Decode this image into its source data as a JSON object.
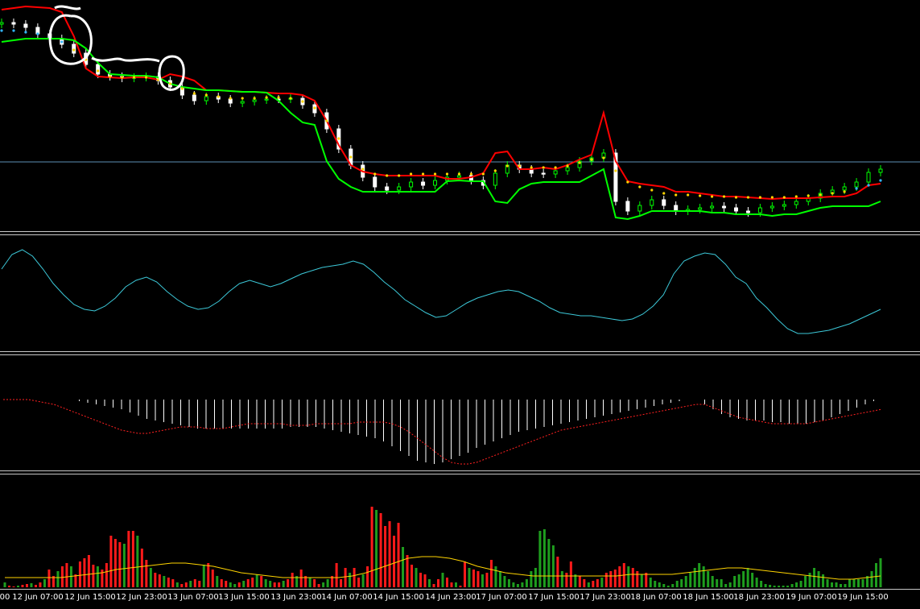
{
  "app": {
    "name": "trading-terminal-chart"
  },
  "colors": {
    "background": "#000000",
    "bull_candle": "#00ff00",
    "bear_candle": "#ffffff",
    "upper_band": "#ff0000",
    "lower_band": "#00ff00",
    "ma_dots": "#ffd400",
    "ma_dots_alt": "#33b5ff",
    "oscillator_line": "#3cc8d8",
    "histogram": "#ffffff",
    "signal_line": "#ff2020",
    "volume_down": "#ff1a1a",
    "volume_up": "#1e9e1e",
    "volume_ma": "#ffd400",
    "horizontal_level": "#5d8fb5",
    "separator": "#c8c8c8",
    "annotation": "#ffffff"
  },
  "time_axis": {
    "labels": [
      "00",
      "12 Jun 07:00",
      "12 Jun 15:00",
      "12 Jun 23:00",
      "13 Jun 07:00",
      "13 Jun 15:00",
      "13 Jun 23:00",
      "14 Jun 07:00",
      "14 Jun 15:00",
      "14 Jun 23:00",
      "17 Jun 07:00",
      "17 Jun 15:00",
      "17 Jun 23:00",
      "18 Jun 07:00",
      "18 Jun 15:00",
      "18 Jun 23:00",
      "19 Jun 07:00",
      "19 Jun 15:00"
    ]
  },
  "chart_data": [
    {
      "type": "line",
      "panel": "price",
      "title": "",
      "close": [
        28,
        30,
        34,
        42,
        48,
        55,
        66,
        80,
        92,
        95,
        97,
        96,
        95,
        100,
        108,
        118,
        125,
        120,
        123,
        128,
        126,
        124,
        123,
        123,
        122,
        130,
        140,
        160,
        185,
        205,
        220,
        232,
        236,
        232,
        226,
        230,
        224,
        220,
        218,
        224,
        230,
        215,
        205,
        210,
        215,
        216,
        212,
        208,
        200,
        196,
        190,
        250,
        262,
        255,
        248,
        255,
        262,
        260,
        258,
        256,
        258,
        262,
        264,
        258,
        256,
        254,
        250,
        246,
        240,
        236,
        232,
        226,
        214,
        210
      ],
      "upper_band": [
        12,
        10,
        8,
        9,
        10,
        15,
        45,
        85,
        95,
        96,
        97,
        96,
        96,
        99,
        92,
        95,
        100,
        112,
        112,
        113,
        114,
        114,
        115,
        116,
        116,
        118,
        125,
        150,
        180,
        205,
        213,
        216,
        218,
        218,
        218,
        218,
        218,
        222,
        222,
        220,
        215,
        190,
        188,
        210,
        210,
        208,
        210,
        205,
        198,
        192,
        140,
        200,
        225,
        228,
        230,
        232,
        238,
        238,
        240,
        242,
        244,
        244,
        245,
        246,
        247,
        246,
        246,
        246,
        245,
        244,
        244,
        240,
        230,
        228
      ],
      "lower_band": [
        52,
        50,
        48,
        48,
        48,
        48,
        50,
        60,
        78,
        92,
        93,
        94,
        94,
        96,
        104,
        108,
        110,
        112,
        112,
        113,
        114,
        114,
        115,
        125,
        140,
        152,
        155,
        200,
        222,
        232,
        238,
        238,
        238,
        238,
        238,
        238,
        238,
        225,
        224,
        225,
        225,
        250,
        252,
        235,
        228,
        226,
        226,
        226,
        226,
        218,
        210,
        270,
        272,
        268,
        262,
        262,
        262,
        262,
        262,
        264,
        264,
        266,
        266,
        266,
        268,
        266,
        266,
        262,
        258,
        256,
        256,
        256,
        256,
        250
      ],
      "moving_average": [
        38,
        38,
        40,
        42,
        46,
        52,
        62,
        74,
        88,
        95,
        96,
        96,
        96,
        99,
        104,
        110,
        116,
        118,
        120,
        122,
        122,
        122,
        121,
        121,
        122,
        126,
        134,
        150,
        172,
        195,
        210,
        216,
        218,
        218,
        216,
        216,
        216,
        216,
        216,
        216,
        216,
        212,
        206,
        206,
        208,
        208,
        208,
        206,
        202,
        198,
        196,
        212,
        226,
        232,
        236,
        240,
        242,
        242,
        243,
        244,
        244,
        245,
        245,
        245,
        245,
        245,
        244,
        243,
        242,
        240,
        238,
        234,
        230,
        224
      ],
      "horizontal_level": 201
    },
    {
      "type": "line",
      "panel": "oscillator",
      "title": "",
      "values": [
        102,
        120,
        126,
        118,
        102,
        84,
        70,
        58,
        52,
        50,
        56,
        66,
        80,
        88,
        92,
        86,
        74,
        64,
        56,
        52,
        54,
        62,
        74,
        84,
        88,
        84,
        80,
        84,
        90,
        96,
        100,
        104,
        106,
        108,
        112,
        108,
        98,
        86,
        76,
        64,
        56,
        48,
        42,
        44,
        52,
        60,
        66,
        70,
        74,
        76,
        74,
        68,
        62,
        54,
        48,
        46,
        44,
        44,
        42,
        40,
        38,
        40,
        46,
        56,
        70,
        96,
        112,
        118,
        122,
        120,
        108,
        92,
        84,
        66,
        54,
        40,
        28,
        22,
        22,
        24,
        26,
        30,
        34,
        40,
        46,
        52
      ]
    },
    {
      "type": "bar",
      "panel": "macd",
      "title": "",
      "histogram": [
        0,
        0,
        0,
        0,
        0,
        0,
        0,
        0,
        0,
        -2,
        -4,
        -6,
        -8,
        -10,
        -12,
        -16,
        -20,
        -24,
        -26,
        -28,
        -30,
        -32,
        -34,
        -36,
        -36,
        -36,
        -36,
        -36,
        -36,
        -36,
        -36,
        -36,
        -36,
        -36,
        -34,
        -34,
        -34,
        -34,
        -36,
        -38,
        -40,
        -42,
        -44,
        -46,
        -48,
        -52,
        -58,
        -64,
        -70,
        -76,
        -78,
        -80,
        -78,
        -74,
        -70,
        -66,
        -60,
        -56,
        -52,
        -48,
        -44,
        -40,
        -38,
        -36,
        -34,
        -32,
        -30,
        -28,
        -26,
        -24,
        -22,
        -20,
        -18,
        -16,
        -14,
        -12,
        -10,
        -8,
        -6,
        -4,
        -2,
        0,
        0,
        -6,
        -12,
        -18,
        -22,
        -24,
        -26,
        -26,
        -26,
        -28,
        -28,
        -30,
        -30,
        -30,
        -28,
        -26,
        -22,
        -18,
        -14,
        -10,
        -6,
        -2,
        0
      ],
      "signal": [
        0,
        0,
        0,
        0,
        -2,
        -4,
        -6,
        -10,
        -14,
        -18,
        -22,
        -26,
        -30,
        -34,
        -38,
        -40,
        -42,
        -42,
        -40,
        -38,
        -36,
        -34,
        -34,
        -34,
        -36,
        -36,
        -36,
        -34,
        -32,
        -30,
        -30,
        -30,
        -30,
        -30,
        -32,
        -32,
        -32,
        -30,
        -30,
        -30,
        -30,
        -30,
        -28,
        -28,
        -28,
        -28,
        -30,
        -34,
        -40,
        -48,
        -56,
        -64,
        -72,
        -78,
        -80,
        -80,
        -78,
        -74,
        -70,
        -66,
        -62,
        -58,
        -54,
        -50,
        -46,
        -42,
        -38,
        -36,
        -34,
        -32,
        -30,
        -28,
        -26,
        -24,
        -22,
        -20,
        -18,
        -16,
        -14,
        -12,
        -10,
        -8,
        -6,
        -6,
        -10,
        -14,
        -18,
        -22,
        -24,
        -26,
        -28,
        -30,
        -30,
        -30,
        -30,
        -30,
        -28,
        -26,
        -24,
        -22,
        -20,
        -18,
        -16,
        -14,
        -12
      ]
    },
    {
      "type": "bar",
      "panel": "volume",
      "title": "",
      "values": [
        6,
        2,
        1,
        2,
        3,
        4,
        5,
        3,
        6,
        10,
        22,
        14,
        20,
        26,
        30,
        26,
        16,
        32,
        36,
        40,
        28,
        26,
        22,
        30,
        64,
        60,
        56,
        54,
        70,
        70,
        64,
        48,
        34,
        24,
        18,
        16,
        14,
        12,
        10,
        6,
        4,
        6,
        8,
        10,
        8,
        28,
        30,
        22,
        14,
        10,
        8,
        6,
        4,
        6,
        8,
        10,
        12,
        16,
        14,
        10,
        8,
        6,
        6,
        8,
        10,
        18,
        14,
        22,
        14,
        12,
        10,
        4,
        6,
        10,
        14,
        30,
        10,
        24,
        18,
        24,
        12,
        16,
        26,
        100,
        96,
        92,
        76,
        82,
        64,
        80,
        50,
        40,
        28,
        24,
        18,
        16,
        10,
        4,
        10,
        18,
        12,
        6,
        6,
        2,
        32,
        24,
        22,
        20,
        16,
        18,
        34,
        26,
        20,
        14,
        10,
        6,
        4,
        6,
        10,
        20,
        24,
        70,
        72,
        60,
        52,
        38,
        20,
        18,
        32,
        16,
        14,
        10,
        6,
        8,
        10,
        12,
        18,
        20,
        22,
        26,
        30,
        26,
        24,
        20,
        16,
        18,
        12,
        8,
        6,
        4,
        2,
        4,
        8,
        10,
        14,
        18,
        24,
        30,
        26,
        20,
        14,
        10,
        10,
        4,
        6,
        14,
        16,
        20,
        24,
        18,
        12,
        8,
        4,
        3,
        2,
        2,
        2,
        2,
        4,
        6,
        8,
        14,
        18,
        24,
        20,
        16,
        10,
        6,
        6,
        4,
        4,
        10,
        10,
        10,
        10,
        14,
        20,
        30,
        36
      ],
      "volume_ma": [
        12,
        12,
        12,
        12,
        12,
        14,
        16,
        18,
        22,
        24,
        26,
        28,
        30,
        30,
        28,
        26,
        22,
        18,
        16,
        14,
        12,
        12,
        12,
        12,
        12,
        14,
        18,
        24,
        30,
        36,
        38,
        38,
        36,
        32,
        26,
        22,
        18,
        16,
        14,
        14,
        14,
        14,
        14,
        14,
        14,
        16,
        16,
        16,
        16,
        18,
        20,
        22,
        24,
        24,
        22,
        20,
        18,
        16,
        14,
        12,
        10,
        10,
        12,
        14
      ]
    }
  ]
}
